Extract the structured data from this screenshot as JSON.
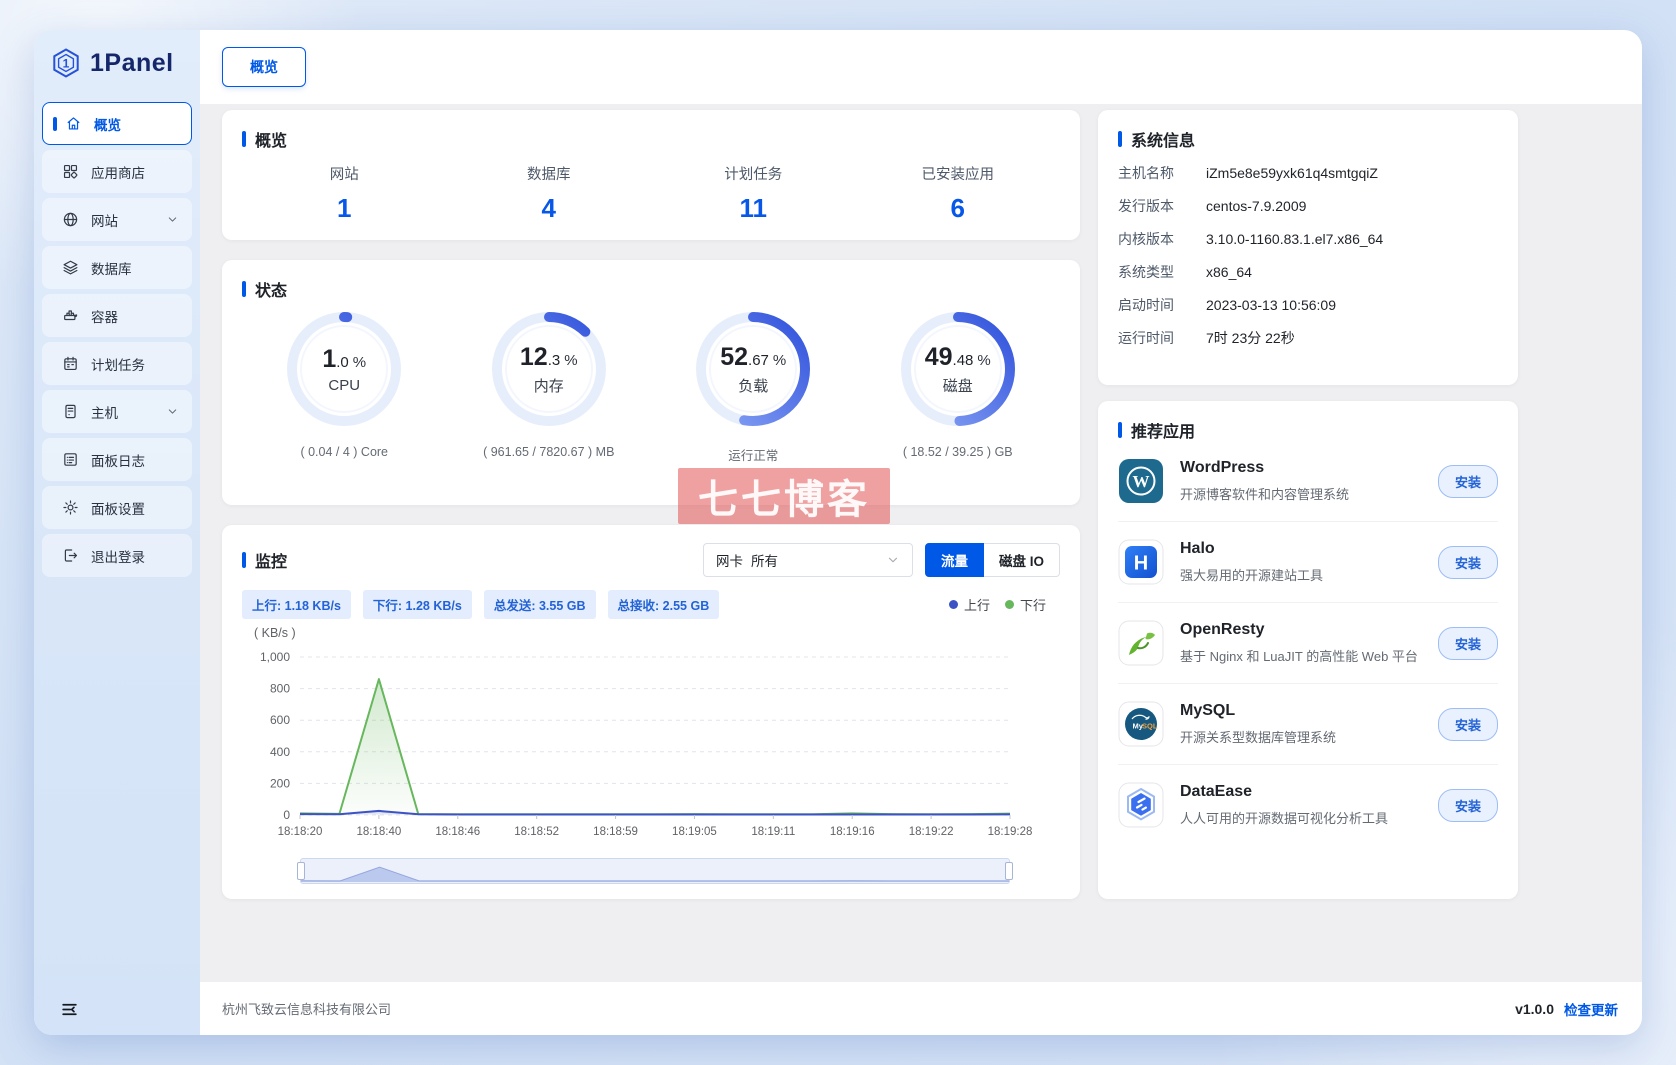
{
  "app": {
    "logo_text": "1Panel"
  },
  "colors": {
    "primary": "#0058e6",
    "stat_value": "#0757e8",
    "gauge_track": "#e7eefb",
    "gauge_arc": "#3b5ddf",
    "tag_bg": "#e3edfd",
    "tag_text": "#2363d6",
    "up_series": "#3d53c5",
    "down_series": "#67b75d",
    "watermark_red": "#e25454"
  },
  "topbar": {
    "tab": "概览"
  },
  "sidebar": {
    "items": [
      {
        "key": "overview",
        "label": "概览",
        "icon": "home-icon",
        "selected": true
      },
      {
        "key": "app-store",
        "label": "应用商店",
        "icon": "appstore-icon"
      },
      {
        "key": "website",
        "label": "网站",
        "icon": "globe-icon",
        "chevron": true
      },
      {
        "key": "database",
        "label": "数据库",
        "icon": "database-icon"
      },
      {
        "key": "container",
        "label": "容器",
        "icon": "container-icon"
      },
      {
        "key": "cronjob",
        "label": "计划任务",
        "icon": "calendar-icon"
      },
      {
        "key": "host",
        "label": "主机",
        "icon": "host-icon",
        "chevron": true
      },
      {
        "key": "panel-log",
        "label": "面板日志",
        "icon": "log-icon"
      },
      {
        "key": "panel-settings",
        "label": "面板设置",
        "icon": "settings-icon"
      },
      {
        "key": "logout",
        "label": "退出登录",
        "icon": "logout-icon"
      }
    ]
  },
  "overview": {
    "title": "概览",
    "stats": [
      {
        "label": "网站",
        "value": "1"
      },
      {
        "label": "数据库",
        "value": "4"
      },
      {
        "label": "计划任务",
        "value": "11"
      },
      {
        "label": "已安装应用",
        "value": "6"
      }
    ]
  },
  "status": {
    "title": "状态",
    "gauges": [
      {
        "value_int": "1",
        "value_dec": ".0",
        "unit": "%",
        "label": "CPU",
        "caption": "( 0.04 / 4 ) Core",
        "percent": 1.0
      },
      {
        "value_int": "12",
        "value_dec": ".3",
        "unit": "%",
        "label": "内存",
        "caption": "( 961.65 / 7820.67 ) MB",
        "percent": 12.3
      },
      {
        "value_int": "52",
        "value_dec": ".67",
        "unit": "%",
        "label": "负载",
        "caption": "运行正常",
        "percent": 52.67
      },
      {
        "value_int": "49",
        "value_dec": ".48",
        "unit": "%",
        "label": "磁盘",
        "caption": "( 18.52 / 39.25 ) GB",
        "percent": 49.48
      }
    ]
  },
  "monitor": {
    "title": "监控",
    "nic_prefix": "网卡",
    "nic_value": "所有",
    "buttons": [
      {
        "label": "流量",
        "active": true
      },
      {
        "label": "磁盘 IO",
        "active": false
      }
    ],
    "tags": [
      "上行: 1.18 KB/s",
      "下行: 1.28 KB/s",
      "总发送: 3.55 GB",
      "总接收: 2.55 GB"
    ],
    "legend": [
      {
        "label": "上行",
        "color": "#3d53c5"
      },
      {
        "label": "下行",
        "color": "#67b75d"
      }
    ]
  },
  "chart_data": {
    "type": "area",
    "unit_label": "( KB/s )",
    "ylim": [
      0,
      1000
    ],
    "y_ticks": [
      0,
      200,
      400,
      600,
      800,
      1000
    ],
    "x_tick_labels": [
      "18:18:20",
      "18:18:40",
      "18:18:46",
      "18:18:52",
      "18:18:59",
      "18:19:05",
      "18:19:11",
      "18:19:16",
      "18:19:22",
      "18:19:28"
    ],
    "series": [
      {
        "name": "上行",
        "color": "#3d53c5",
        "values": [
          6,
          5,
          26,
          5,
          3,
          3,
          3,
          3,
          3,
          3,
          3,
          3,
          3,
          3,
          3,
          3,
          3,
          3,
          4
        ]
      },
      {
        "name": "下行",
        "color": "#67b75d",
        "values": [
          10,
          7,
          860,
          6,
          5,
          5,
          5,
          5,
          5,
          5,
          6,
          5,
          5,
          5,
          10,
          6,
          5,
          6,
          9
        ]
      }
    ],
    "legend_position": "top-right",
    "grid": "horizontal-dashed"
  },
  "system_info": {
    "title": "系统信息",
    "rows": [
      {
        "label": "主机名称",
        "value": "iZm5e8e59yxk61q4smtgqiZ"
      },
      {
        "label": "发行版本",
        "value": "centos-7.9.2009"
      },
      {
        "label": "内核版本",
        "value": "3.10.0-1160.83.1.el7.x86_64"
      },
      {
        "label": "系统类型",
        "value": "x86_64"
      },
      {
        "label": "启动时间",
        "value": "2023-03-13 10:56:09"
      },
      {
        "label": "运行时间",
        "value": "7时 23分 22秒"
      }
    ]
  },
  "apps": {
    "title": "推荐应用",
    "install_label": "安装",
    "items": [
      {
        "key": "wordpress",
        "name": "WordPress",
        "desc": "开源博客软件和内容管理系统",
        "icon": "wordpress-icon"
      },
      {
        "key": "halo",
        "name": "Halo",
        "desc": "强大易用的开源建站工具",
        "icon": "halo-icon"
      },
      {
        "key": "openresty",
        "name": "OpenResty",
        "desc": "基于 Nginx 和 LuaJIT 的高性能 Web 平台",
        "icon": "openresty-icon"
      },
      {
        "key": "mysql",
        "name": "MySQL",
        "desc": "开源关系型数据库管理系统",
        "icon": "mysql-icon"
      },
      {
        "key": "dataease",
        "name": "DataEase",
        "desc": "人人可用的开源数据可视化分析工具",
        "icon": "dataease-icon"
      }
    ]
  },
  "footer": {
    "company": "杭州飞致云信息科技有限公司",
    "version": "v1.0.0",
    "update_link": "检查更新"
  },
  "watermark": {
    "text": "七七博客"
  }
}
